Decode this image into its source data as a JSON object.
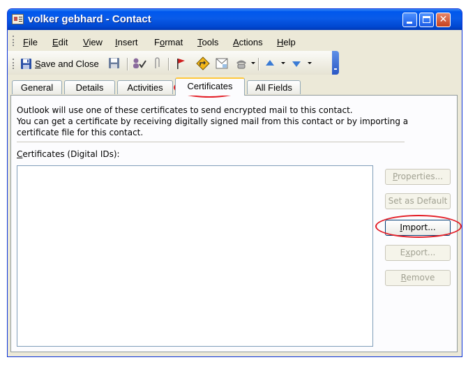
{
  "window": {
    "title": "volker gebhard - Contact"
  },
  "menu": [
    {
      "pre": "",
      "key": "F",
      "post": "ile"
    },
    {
      "pre": "",
      "key": "E",
      "post": "dit"
    },
    {
      "pre": "",
      "key": "V",
      "post": "iew"
    },
    {
      "pre": "",
      "key": "I",
      "post": "nsert"
    },
    {
      "pre": "F",
      "key": "o",
      "post": "rmat"
    },
    {
      "pre": "",
      "key": "T",
      "post": "ools"
    },
    {
      "pre": "",
      "key": "A",
      "post": "ctions"
    },
    {
      "pre": "",
      "key": "H",
      "post": "elp"
    }
  ],
  "toolbar": {
    "save_close_key": "S",
    "save_close_rest": "ave and Close"
  },
  "tabs": [
    "General",
    "Details",
    "Activities",
    "Certificates",
    "All Fields"
  ],
  "panel": {
    "info_lines": [
      "Outlook will use one of these certificates to send encrypted mail to this contact.",
      "You can get a certificate by receiving digitally signed mail from this contact or by importing a",
      "certificate file for this contact."
    ],
    "cert_label_key": "C",
    "cert_label_rest": "ertificates (Digital IDs):",
    "buttons": {
      "properties": {
        "pre": "",
        "key": "P",
        "post": "roperties..."
      },
      "set_default": {
        "label": "Set as Default"
      },
      "import": {
        "pre": "",
        "key": "I",
        "post": "mport..."
      },
      "export": {
        "pre": "E",
        "key": "x",
        "post": "port..."
      },
      "remove": {
        "pre": "",
        "key": "R",
        "post": "emove"
      }
    }
  },
  "colors": {
    "annotation": "#e31c25",
    "title_bar": "#0a5be8",
    "active_tab_highlight": "#ffc83c"
  }
}
